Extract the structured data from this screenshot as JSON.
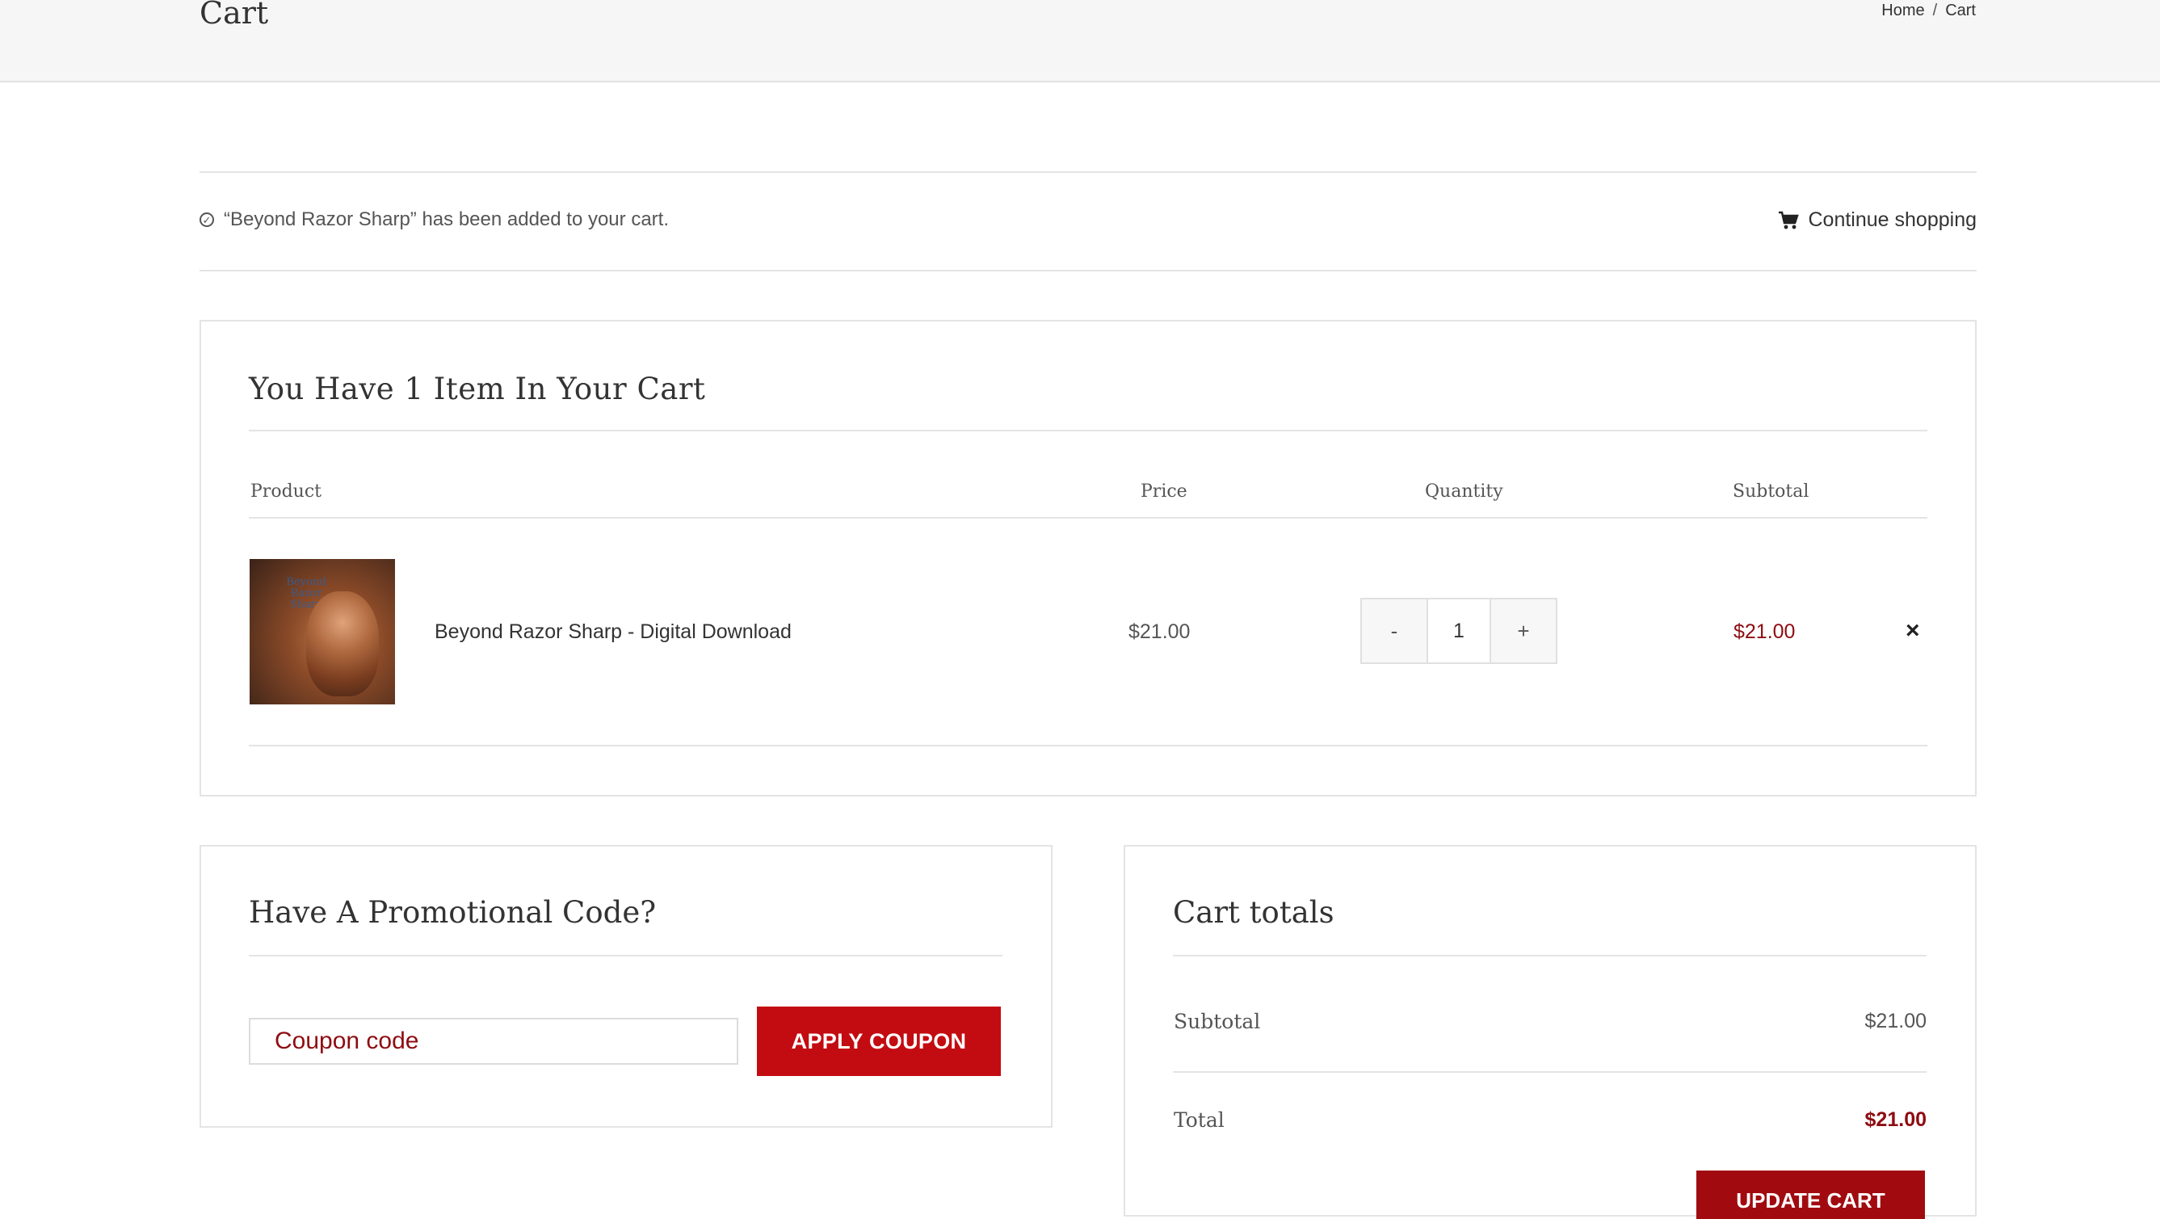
{
  "header": {
    "title": "Cart",
    "breadcrumb": {
      "home": "Home",
      "separator": "/",
      "current": "Cart"
    }
  },
  "notice": {
    "message": "“Beyond Razor Sharp” has been added to your cart.",
    "continue_label": "Continue shopping"
  },
  "cart": {
    "heading": "You Have 1 Item In Your Cart",
    "columns": {
      "product": "Product",
      "price": "Price",
      "quantity": "Quantity",
      "subtotal": "Subtotal"
    },
    "items": [
      {
        "thumbnail_title": "Beyond Razor Sharp",
        "name": "Beyond Razor Sharp - Digital Download",
        "price": "$21.00",
        "quantity": "1",
        "minus": "-",
        "plus": "+",
        "subtotal": "$21.00",
        "remove": "×"
      }
    ]
  },
  "coupon": {
    "heading": "Have A Promotional Code?",
    "placeholder": "Coupon code",
    "button_label": "APPLY COUPON"
  },
  "totals": {
    "heading": "Cart totals",
    "subtotal_label": "Subtotal",
    "subtotal_value": "$21.00",
    "total_label": "Total",
    "total_value": "$21.00",
    "update_label": "UPDATE CART"
  },
  "colors": {
    "accent": "#c30c12",
    "price_red": "#8e0c12",
    "border": "#e4e4e4"
  }
}
